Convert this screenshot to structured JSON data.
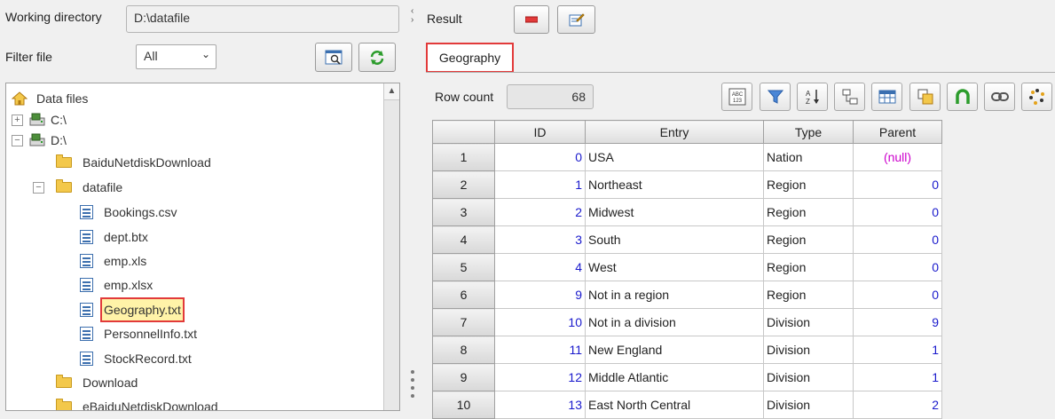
{
  "left": {
    "working_dir_label": "Working directory",
    "working_dir_value": "D:\\datafile",
    "filter_label": "Filter file",
    "filter_value": "All",
    "tree": {
      "root": "Data files",
      "items": [
        {
          "label": "C:\\",
          "kind": "drive"
        },
        {
          "label": "D:\\",
          "kind": "drive"
        },
        {
          "label": "BaiduNetdiskDownload",
          "kind": "folder"
        },
        {
          "label": "datafile",
          "kind": "folder"
        },
        {
          "label": "Bookings.csv",
          "kind": "file"
        },
        {
          "label": "dept.btx",
          "kind": "file"
        },
        {
          "label": "emp.xls",
          "kind": "file"
        },
        {
          "label": "emp.xlsx",
          "kind": "file"
        },
        {
          "label": "Geography.txt",
          "kind": "file"
        },
        {
          "label": "PersonnelInfo.txt",
          "kind": "file"
        },
        {
          "label": "StockRecord.txt",
          "kind": "file"
        },
        {
          "label": "Download",
          "kind": "folder"
        },
        {
          "label": "eBaiduNetdiskDownload",
          "kind": "folder"
        }
      ]
    }
  },
  "right": {
    "result_label": "Result",
    "tab_label": "Geography",
    "row_count_label": "Row count",
    "row_count_value": "68",
    "columns": [
      "ID",
      "Entry",
      "Type",
      "Parent"
    ],
    "rows": [
      {
        "rn": "1",
        "id": "0",
        "entry": "USA",
        "type": "Nation",
        "parent": "(null)"
      },
      {
        "rn": "2",
        "id": "1",
        "entry": "Northeast",
        "type": "Region",
        "parent": "0"
      },
      {
        "rn": "3",
        "id": "2",
        "entry": "Midwest",
        "type": "Region",
        "parent": "0"
      },
      {
        "rn": "4",
        "id": "3",
        "entry": "South",
        "type": "Region",
        "parent": "0"
      },
      {
        "rn": "5",
        "id": "4",
        "entry": "West",
        "type": "Region",
        "parent": "0"
      },
      {
        "rn": "6",
        "id": "9",
        "entry": "Not in a region",
        "type": "Region",
        "parent": "0"
      },
      {
        "rn": "7",
        "id": "10",
        "entry": "Not in a division",
        "type": "Division",
        "parent": "9"
      },
      {
        "rn": "8",
        "id": "11",
        "entry": "New England",
        "type": "Division",
        "parent": "1"
      },
      {
        "rn": "9",
        "id": "12",
        "entry": "Middle Atlantic",
        "type": "Division",
        "parent": "1"
      },
      {
        "rn": "10",
        "id": "13",
        "entry": "East North Central",
        "type": "Division",
        "parent": "2"
      }
    ],
    "toolbar_icons": [
      "abc-123-icon",
      "filter-icon",
      "sort-az-icon",
      "link-tree-icon",
      "grid-icon",
      "copy-icon",
      "magnet-icon",
      "chain-icon",
      "refresh-spinner-icon"
    ]
  },
  "colors": {
    "highlight_border": "#e23a3a",
    "number_blue": "#1a1acc",
    "null_magenta": "#cc00cc"
  }
}
